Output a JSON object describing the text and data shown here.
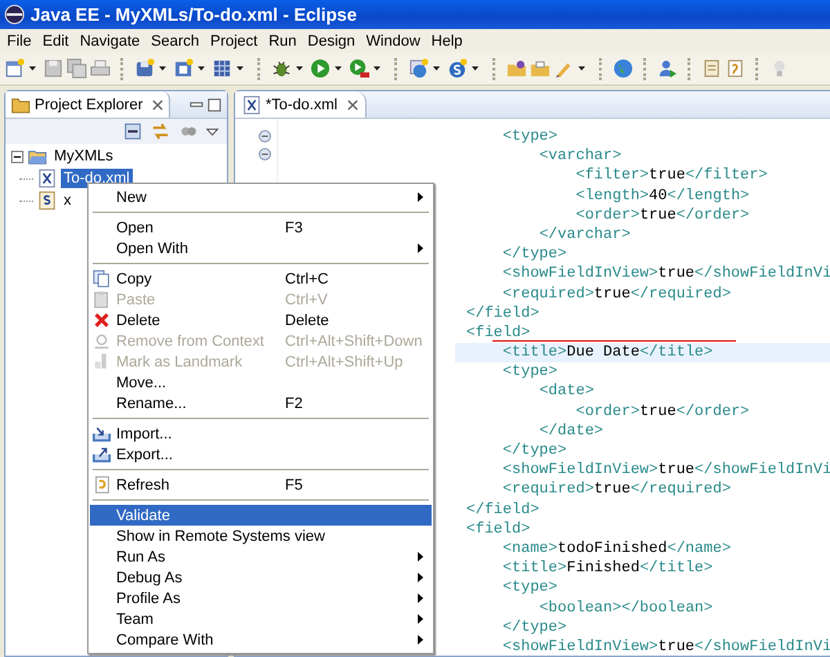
{
  "window": {
    "title": "Java EE - MyXMLs/To-do.xml - Eclipse"
  },
  "menu_bar": [
    "File",
    "Edit",
    "Navigate",
    "Search",
    "Project",
    "Run",
    "Design",
    "Window",
    "Help"
  ],
  "project_explorer": {
    "title": "Project Explorer",
    "tree": [
      {
        "label": "MyXMLs",
        "kind": "folder",
        "expanded": true,
        "selected": false,
        "children": [
          {
            "label": "To-do.xml",
            "kind": "xml",
            "selected": true
          },
          {
            "label": "x",
            "kind": "schema",
            "selected": false
          }
        ]
      }
    ]
  },
  "editor": {
    "tab": "*To-do.xml",
    "lines": [
      {
        "text": "    <type>",
        "current": false
      },
      {
        "text": "        <varchar>",
        "current": false
      },
      {
        "text": "            <filter>true</filter>",
        "current": false
      },
      {
        "text": "            <length>40</length>",
        "current": false
      },
      {
        "text": "            <order>true</order>",
        "current": false
      },
      {
        "text": "        </varchar>",
        "current": false
      },
      {
        "text": "    </type>",
        "current": false
      },
      {
        "text": "    <showFieldInView>true</showFieldInVi",
        "current": false
      },
      {
        "text": "    <required>true</required>",
        "current": false
      },
      {
        "text": "</field>",
        "current": false
      },
      {
        "text": "<field>",
        "current": false
      },
      {
        "text": "    <title>Due Date</title>",
        "current": true
      },
      {
        "text": "    <type>",
        "current": false
      },
      {
        "text": "        <date>",
        "current": false
      },
      {
        "text": "            <order>true</order>",
        "current": false
      },
      {
        "text": "        </date>",
        "current": false
      },
      {
        "text": "    </type>",
        "current": false
      },
      {
        "text": "    <showFieldInView>true</showFieldInVi",
        "current": false
      },
      {
        "text": "    <required>true</required>",
        "current": false
      },
      {
        "text": "</field>",
        "current": false
      },
      {
        "text": "<field>",
        "current": false
      },
      {
        "text": "    <name>todoFinished</name>",
        "current": false
      },
      {
        "text": "    <title>Finished</title>",
        "current": false
      },
      {
        "text": "    <type>",
        "current": false
      },
      {
        "text": "        <boolean></boolean>",
        "current": false
      },
      {
        "text": "    </type>",
        "current": false
      },
      {
        "text": "    <showFieldInView>true</showFieldInVi",
        "current": false
      }
    ]
  },
  "context_menu": [
    {
      "kind": "item",
      "label": "New",
      "submenu": true,
      "disabled": false,
      "selected": false
    },
    {
      "kind": "separator"
    },
    {
      "kind": "item",
      "label": "Open",
      "shortcut": "F3",
      "submenu": false,
      "disabled": false,
      "selected": false
    },
    {
      "kind": "item",
      "label": "Open With",
      "submenu": true,
      "disabled": false,
      "selected": false
    },
    {
      "kind": "separator"
    },
    {
      "kind": "item",
      "label": "Copy",
      "shortcut": "Ctrl+C",
      "submenu": false,
      "disabled": false,
      "selected": false
    },
    {
      "kind": "item",
      "label": "Paste",
      "shortcut": "Ctrl+V",
      "submenu": false,
      "disabled": true,
      "selected": false
    },
    {
      "kind": "item",
      "label": "Delete",
      "shortcut": "Delete",
      "submenu": false,
      "disabled": false,
      "selected": false
    },
    {
      "kind": "item",
      "label": "Remove from Context",
      "shortcut": "Ctrl+Alt+Shift+Down",
      "submenu": false,
      "disabled": true,
      "selected": false
    },
    {
      "kind": "item",
      "label": "Mark as Landmark",
      "shortcut": "Ctrl+Alt+Shift+Up",
      "submenu": false,
      "disabled": true,
      "selected": false
    },
    {
      "kind": "item",
      "label": "Move...",
      "submenu": false,
      "disabled": false,
      "selected": false
    },
    {
      "kind": "item",
      "label": "Rename...",
      "shortcut": "F2",
      "submenu": false,
      "disabled": false,
      "selected": false
    },
    {
      "kind": "separator"
    },
    {
      "kind": "item",
      "label": "Import...",
      "submenu": false,
      "disabled": false,
      "selected": false
    },
    {
      "kind": "item",
      "label": "Export...",
      "submenu": false,
      "disabled": false,
      "selected": false
    },
    {
      "kind": "separator"
    },
    {
      "kind": "item",
      "label": "Refresh",
      "shortcut": "F5",
      "submenu": false,
      "disabled": false,
      "selected": false
    },
    {
      "kind": "separator"
    },
    {
      "kind": "item",
      "label": "Validate",
      "submenu": false,
      "disabled": false,
      "selected": true
    },
    {
      "kind": "item",
      "label": "Show in Remote Systems view",
      "submenu": false,
      "disabled": false,
      "selected": false
    },
    {
      "kind": "item",
      "label": "Run As",
      "submenu": true,
      "disabled": false,
      "selected": false
    },
    {
      "kind": "item",
      "label": "Debug As",
      "submenu": true,
      "disabled": false,
      "selected": false
    },
    {
      "kind": "item",
      "label": "Profile As",
      "submenu": true,
      "disabled": false,
      "selected": false
    },
    {
      "kind": "item",
      "label": "Team",
      "submenu": true,
      "disabled": false,
      "selected": false
    },
    {
      "kind": "item",
      "label": "Compare With",
      "submenu": true,
      "disabled": false,
      "selected": false
    }
  ]
}
